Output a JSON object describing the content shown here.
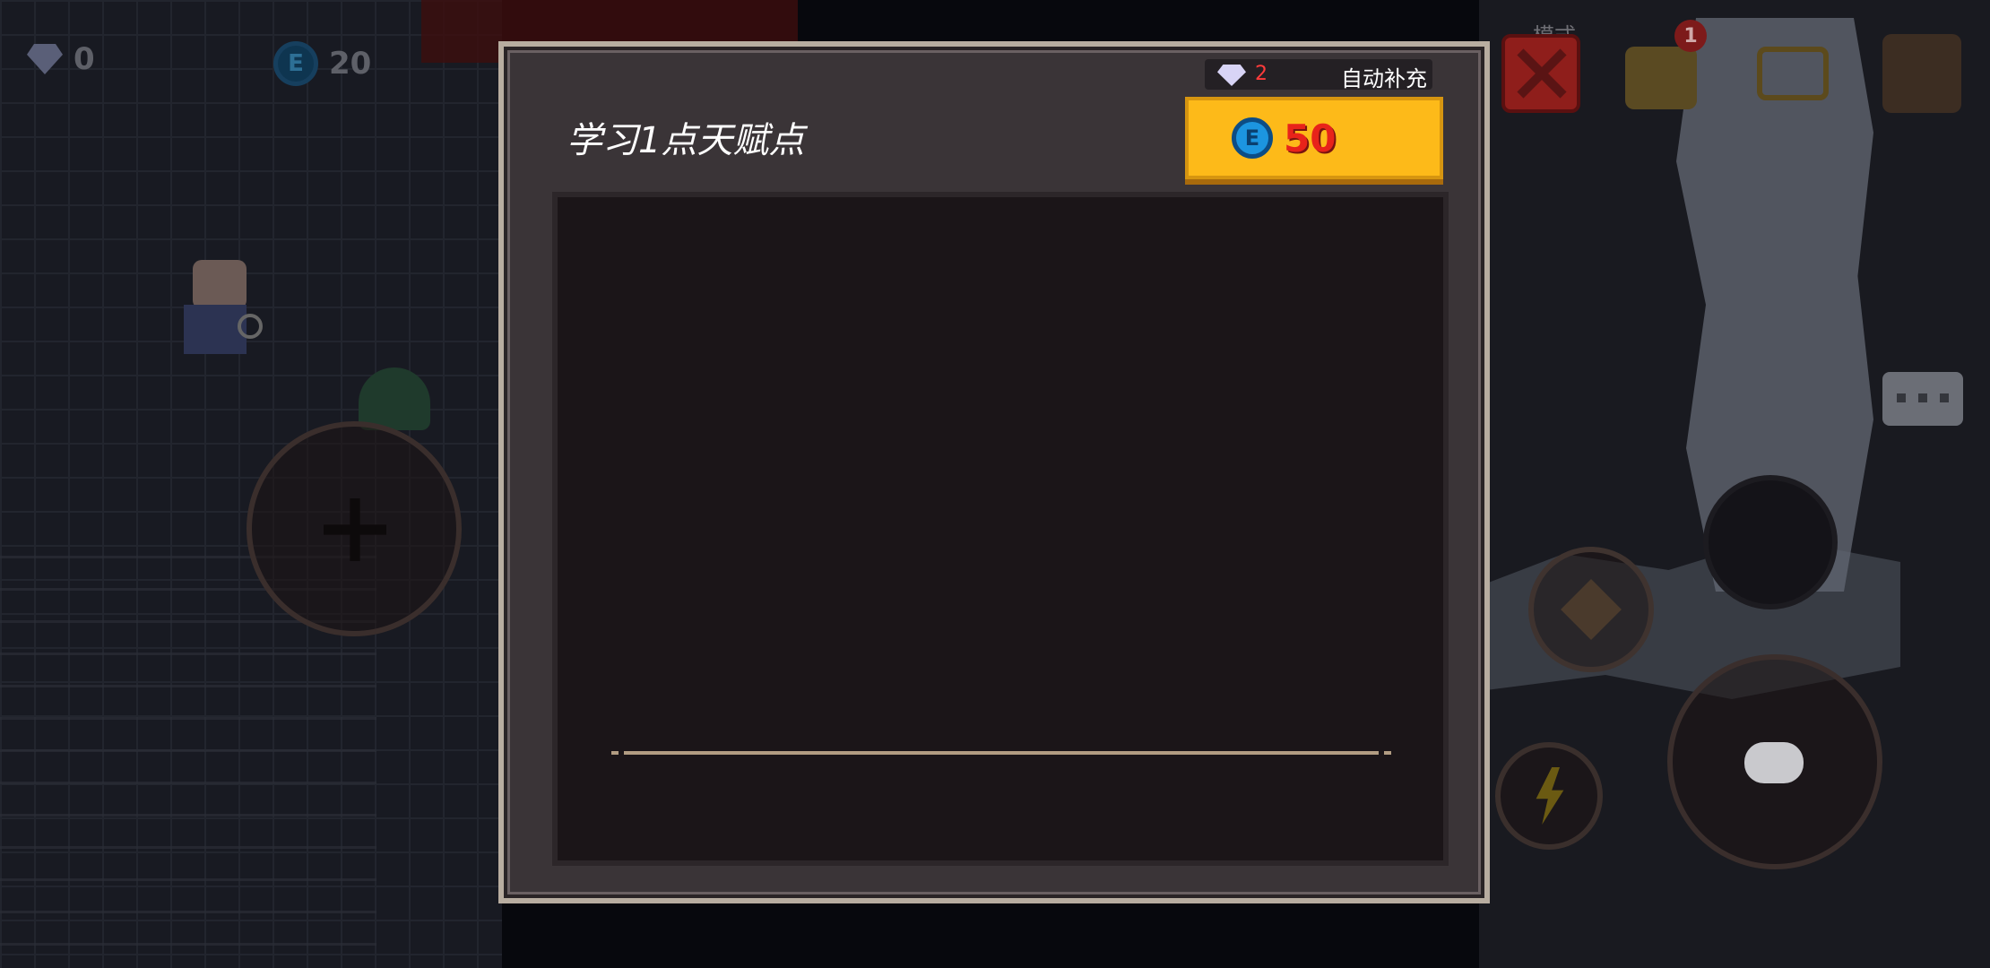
{
  "hud": {
    "gems": "0",
    "coins": "20",
    "coin_symbol": "E",
    "mode_label": "模式",
    "chest_badge": "1"
  },
  "dialog": {
    "title": "学习1点天赋点",
    "gem_count": "2",
    "auto_refill_label": "自动补充",
    "price": "50",
    "price_coin_symbol": "E"
  },
  "colors": {
    "price_button": "#fdba19",
    "price_text": "#e8231a",
    "gem_count": "#ff3b3b",
    "panel_bg": "#1b1518"
  },
  "icons": [
    "gem-icon",
    "coin-icon",
    "close-icon",
    "chest-icon",
    "cart-icon",
    "pause-icon",
    "chat-icon",
    "lightning-icon"
  ]
}
